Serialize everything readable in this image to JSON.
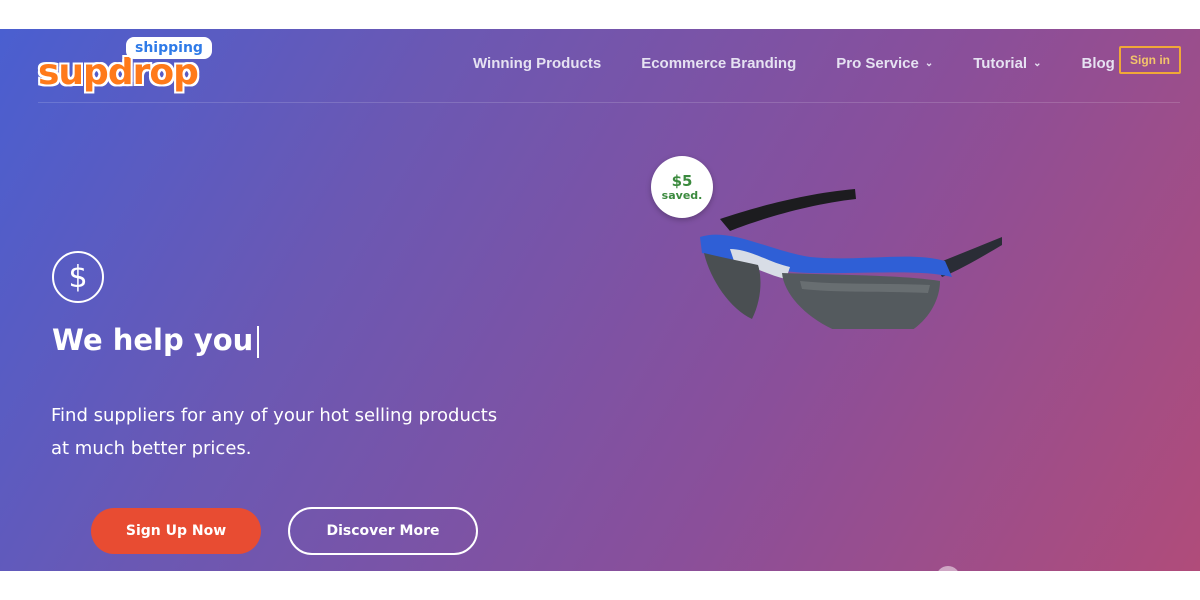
{
  "brand": {
    "logo_main": "supdrop",
    "logo_badge": "shipping"
  },
  "nav": {
    "items": [
      {
        "label": "Winning Products",
        "has_dropdown": false
      },
      {
        "label": "Ecommerce Branding",
        "has_dropdown": false
      },
      {
        "label": "Pro Service",
        "has_dropdown": true
      },
      {
        "label": "Tutorial",
        "has_dropdown": true
      },
      {
        "label": "Blog",
        "has_dropdown": false
      }
    ],
    "signin_label": "Sign in"
  },
  "hero": {
    "icon": "dollar-icon",
    "headline": "We help you",
    "description_line1": "Find suppliers for any of your hot selling products",
    "description_line2": "at much better prices.",
    "primary_cta": "Sign Up Now",
    "secondary_cta": "Discover More",
    "badge_amount": "$5",
    "badge_label": "saved.",
    "product_image": "sport-sunglasses"
  },
  "colors": {
    "gradient_start": "#4a5fd0",
    "gradient_end": "#b04c7a",
    "cta_primary": "#e84c32",
    "signin_border": "#f0a838",
    "logo_orange": "#ff7a1a",
    "logo_blue": "#2f7be8",
    "badge_green": "#3b8a3e"
  }
}
